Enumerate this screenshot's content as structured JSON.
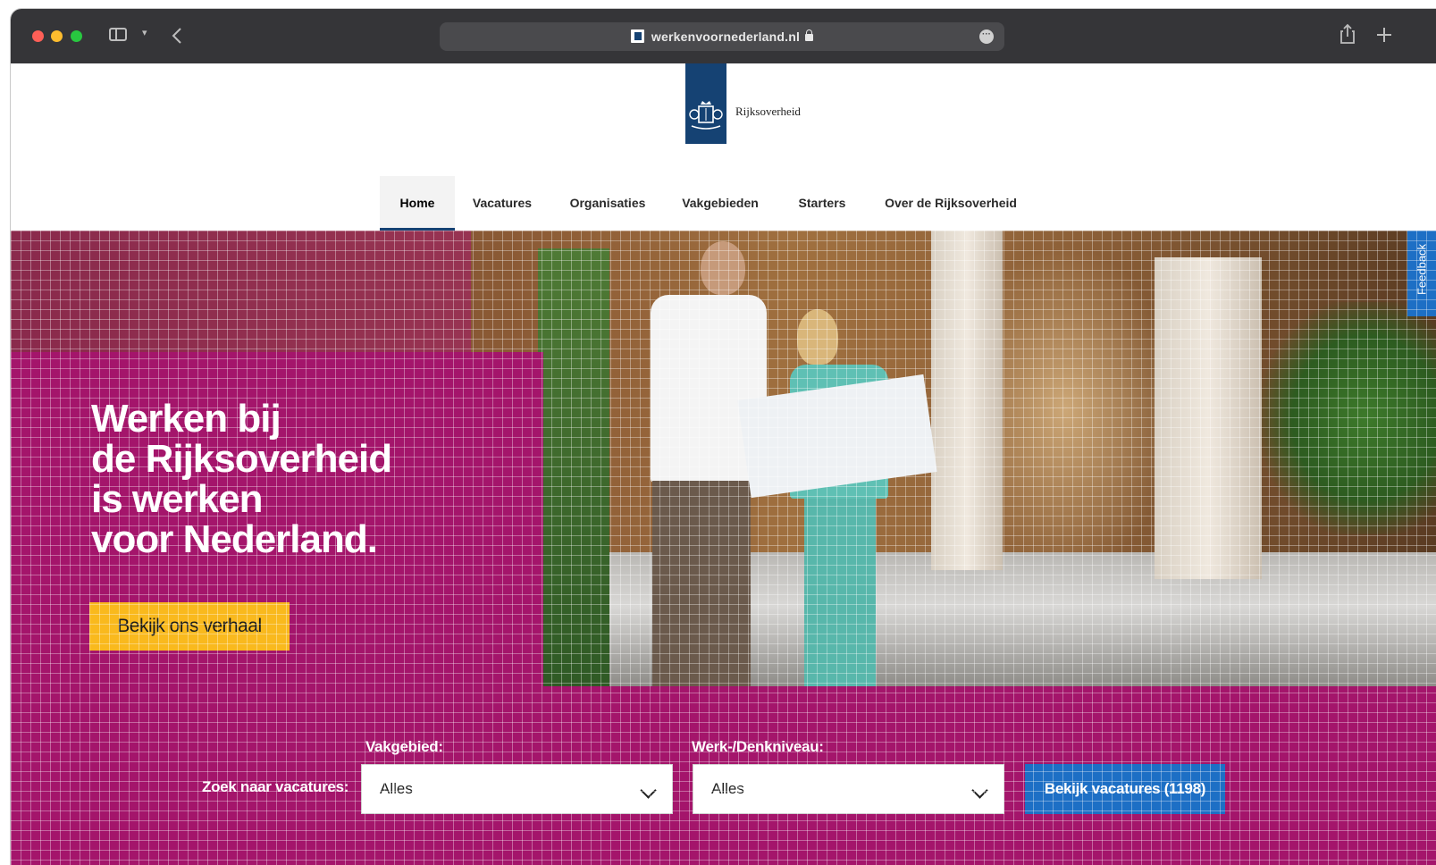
{
  "browser": {
    "url": "werkenvoornederland.nl",
    "icons": [
      "sidebar-icon",
      "chevron-down-icon",
      "back-icon",
      "lock-icon",
      "more-icon",
      "share-icon",
      "new-tab-icon"
    ]
  },
  "header": {
    "logo_text": "Rijksoverheid"
  },
  "nav": {
    "items": [
      {
        "label": "Home",
        "active": true
      },
      {
        "label": "Vacatures"
      },
      {
        "label": "Organisaties"
      },
      {
        "label": "Vakgebieden"
      },
      {
        "label": "Starters"
      },
      {
        "label": "Over de Rijksoverheid"
      }
    ]
  },
  "hero": {
    "title_lines": [
      "Werken bij",
      "de Rijksoverheid",
      "is werken",
      "voor Nederland."
    ],
    "cta_label": "Bekijk ons verhaal",
    "feedback_label": "Feedback"
  },
  "search": {
    "label": "Zoek naar vacatures:",
    "vakgebied_label": "Vakgebied:",
    "vakgebied_value": "Alles",
    "niveau_label": "Werk-/Denkniveau:",
    "niveau_value": "Alles",
    "submit_label": "Bekijk vacatures (1198)"
  },
  "colors": {
    "brand_blue": "#154273",
    "magenta": "#a4156b",
    "cta_yellow": "#f9b91d",
    "button_blue": "#1d6fc5"
  }
}
